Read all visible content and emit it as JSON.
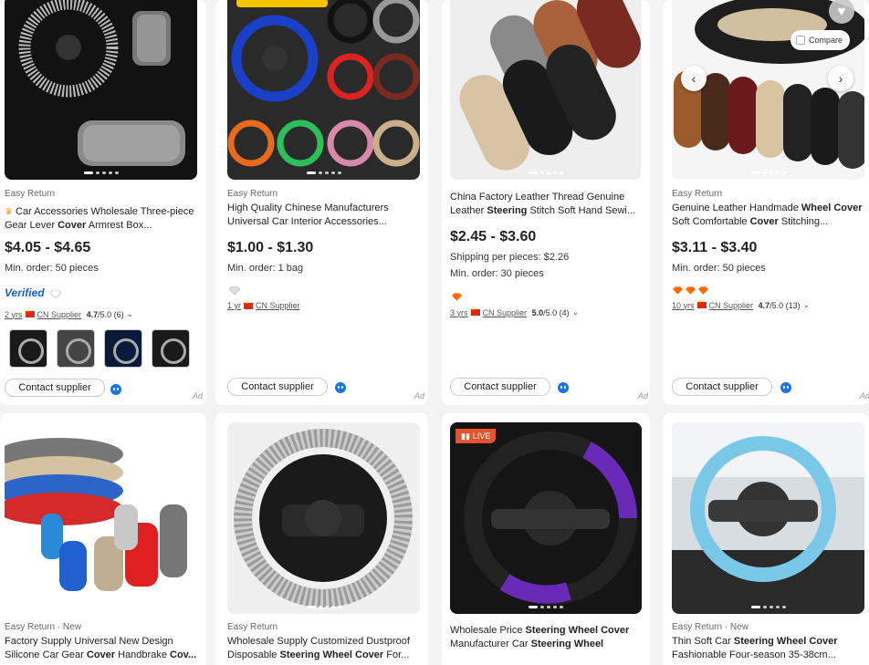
{
  "products": [
    {
      "tag": "Easy Return",
      "title_html": "Car Accessories Wholesale Three-piece Gear Lever <b>Cover</b> Armrest Box...",
      "price": "$4.05 - $4.65",
      "min_order": "Min. order: 50 pieces",
      "verified": "Verified",
      "years": "2 yrs",
      "supplier": "CN Supplier",
      "rating": "4.7",
      "rating_detail": "/5.0 (6)",
      "contact": "Contact supplier",
      "ad": "Ad"
    },
    {
      "tag": "Easy Return",
      "title_html": "High Quality Chinese Manufacturers Universal Car Interior Accessories...",
      "price": "$1.00 - $1.30",
      "min_order": "Min. order: 1 bag",
      "years": "1 yr",
      "supplier": "CN Supplier",
      "contact": "Contact supplier",
      "ad": "Ad"
    },
    {
      "title_html": "China Factory Leather Thread Genuine Leather <b>Steering</b> Stitch Soft Hand Sewi...",
      "price": "$2.45 - $3.60",
      "shipping": "Shipping per pieces: $2.26",
      "min_order": "Min. order: 30 pieces",
      "years": "3 yrs",
      "supplier": "CN Supplier",
      "rating": "5.0",
      "rating_detail": "/5.0 (4)",
      "contact": "Contact supplier",
      "ad": "Ad"
    },
    {
      "tag": "Easy Return",
      "title_html": "Genuine Leather Handmade <b>Wheel Cover</b> Soft Comfortable <b>Cover</b> Stitching...",
      "price": "$3.11 - $3.40",
      "min_order": "Min. order: 50 pieces",
      "years": "10 yrs",
      "supplier": "CN Supplier",
      "rating": "4.7",
      "rating_detail": "/5.0 (13)",
      "contact": "Contact supplier",
      "compare": "Compare",
      "ad": "Ad"
    },
    {
      "tag": "Easy Return · New",
      "title_html": "Factory Supply Universal New Design Silicone Car Gear <b>Cover</b> Handbrake <b>Cov...</b>"
    },
    {
      "tag": "Easy Return",
      "title_html": "Wholesale Supply Customized Dustproof Disposable <b>Steering Wheel Cover</b> For..."
    },
    {
      "live": "LIVE",
      "title_html": "Wholesale Price <b>Steering Wheel Cover</b> Manufacturer Car <b>Steering Wheel Cover...</b>"
    },
    {
      "tag": "Easy Return · New",
      "title_html": "Thin Soft Car <b>Steering Wheel Cover</b> Fashionable Four-season 35-38cm..."
    }
  ],
  "colors": {
    "price": "#222222",
    "verified": "#1462d2",
    "chat": "#1a73e8",
    "live": "#e5532c",
    "diamond": "#ff6a00"
  }
}
